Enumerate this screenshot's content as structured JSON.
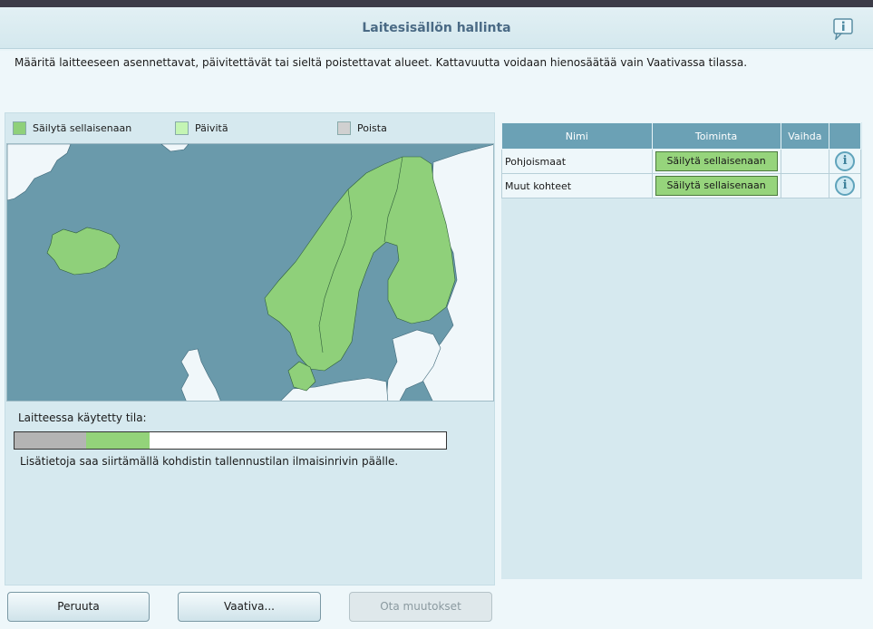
{
  "header": {
    "title": "Laitesisällön hallinta",
    "help_icon": "info-speech-bubble-icon"
  },
  "description": "Määritä laitteeseen asennettavat, päivitettävät tai sieltä poistettavat alueet. Kattavuutta voidaan hienosäätää vain Vaativassa tilassa.",
  "legend": [
    {
      "label": "Säilytä sellaisenaan",
      "color": "#8fd07a"
    },
    {
      "label": "Päivitä",
      "color": "#c4f5b4"
    },
    {
      "label": "Poista",
      "color": "#d0d0d0"
    }
  ],
  "storage": {
    "label": "Laitteessa käytetty tila:",
    "used_fraction": 0.165,
    "keep_fraction": 0.147,
    "hint": "Lisätietoja saa siirtämällä kohdistin tallennustilan ilmaisinrivin päälle."
  },
  "table": {
    "headers": [
      "Nimi",
      "Toiminta",
      "Vaihda",
      ""
    ],
    "rows": [
      {
        "name": "Pohjoismaat",
        "action": "Säilytä sellaisenaan"
      },
      {
        "name": "Muut kohteet",
        "action": "Säilytä sellaisenaan"
      }
    ]
  },
  "buttons": {
    "cancel": "Peruuta",
    "advanced": "Vaativa...",
    "apply": "Ota muutokset käyttöön..."
  },
  "colors": {
    "sea": "#6a9aab",
    "keep": "#8fd07a",
    "land_other": "#f0f7fa"
  }
}
